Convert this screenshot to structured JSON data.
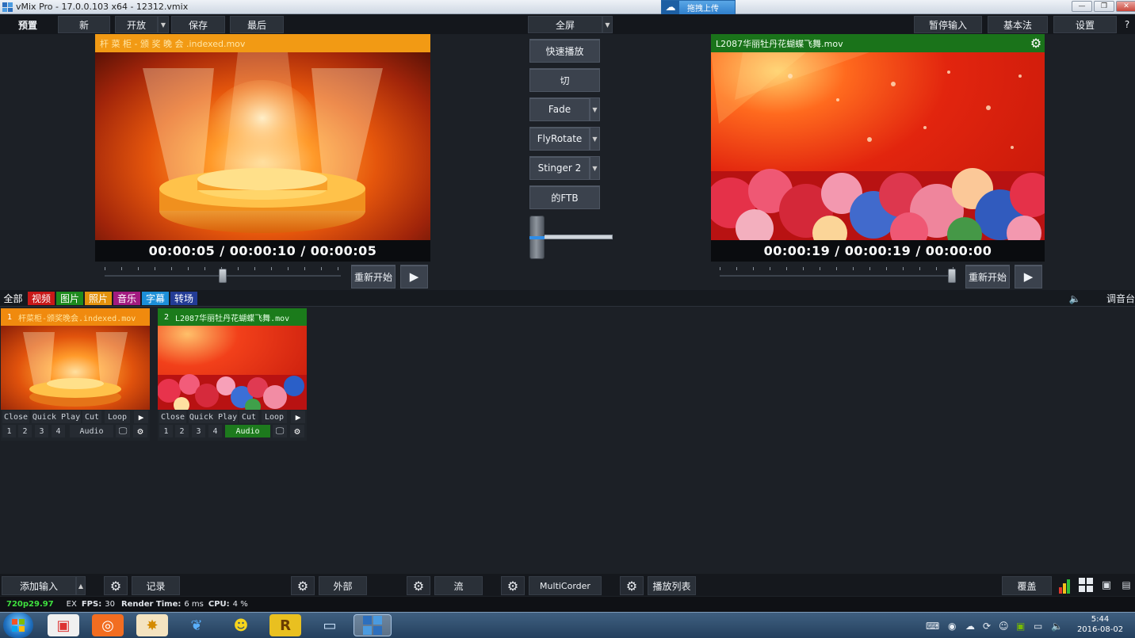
{
  "window": {
    "title": "vMix Pro - 17.0.0.103 x64 - 12312.vmix",
    "upload_label": "拖拽上传",
    "minimize": "—",
    "restore": "❐",
    "close": "✕"
  },
  "toolbar": {
    "preview_label": "预置",
    "new_label": "新",
    "open_label": "开放",
    "save_label": "保存",
    "last_label": "最后",
    "fullscreen_label": "全屏",
    "pause_input_label": "暂停输入",
    "basic_label": "基本法",
    "settings_label": "设置",
    "help_label": "?"
  },
  "preview": {
    "title": "杆 菜 柜 - 颁 奖 晚 会 .indexed.mov",
    "timecode": "00:00:05 / 00:00:10 / 00:00:05",
    "position": 0.5,
    "restart_label": "重新开始",
    "play_glyph": "▶"
  },
  "output": {
    "title": "L2087华丽牡丹花蝴蝶飞舞.mov",
    "timecode": "00:00:19 / 00:00:19 / 00:00:00",
    "position": 1.0,
    "restart_label": "重新开始",
    "play_glyph": "▶"
  },
  "transitions": {
    "quick_play_label": "快速播放",
    "cut_label": "切",
    "t1_label": "Fade",
    "t2_label": "FlyRotate",
    "t3_label": "Stinger 2",
    "ftb_label": "的FTB",
    "tbar_position": 0.0
  },
  "categories": {
    "all": "全部",
    "video": "视频",
    "image": "图片",
    "photo": "照片",
    "music": "音乐",
    "title": "字幕",
    "transition": "转场",
    "mixer_label": "调音台"
  },
  "inputs": [
    {
      "number": "1",
      "name": "杆菜柜-颁奖晚会.indexed.mov",
      "header_color": "#f08a0e",
      "text_color": "#ffe39a",
      "close": "Close",
      "quick_play": "Quick Play",
      "cut": "Cut",
      "loop": "Loop",
      "n1": "1",
      "n2": "2",
      "n3": "3",
      "n4": "4",
      "audio": "Audio",
      "audio_active": false
    },
    {
      "number": "2",
      "name": "L2087华丽牡丹花蝴蝶飞舞.mov",
      "header_color": "#1b7b1b",
      "text_color": "#e6ffe6",
      "close": "Close",
      "quick_play": "Quick Play",
      "cut": "Cut",
      "loop": "Loop",
      "n1": "1",
      "n2": "2",
      "n3": "3",
      "n4": "4",
      "audio": "Audio",
      "audio_active": true
    }
  ],
  "bottom": {
    "add_input_label": "添加输入",
    "record_label": "记录",
    "external_label": "外部",
    "stream_label": "流",
    "multicorder_label": "MultiCorder",
    "playlist_label": "播放列表",
    "overlay_label": "覆盖"
  },
  "status": {
    "resolution": "720p29.97",
    "ex": "EX",
    "fps_label": "FPS:",
    "fps": "30",
    "render_label": "Render Time:",
    "render": "6 ms",
    "cpu_label": "CPU:",
    "cpu": "4 %"
  },
  "taskbar": {
    "time": "5:44",
    "date": "2016-08-02"
  }
}
